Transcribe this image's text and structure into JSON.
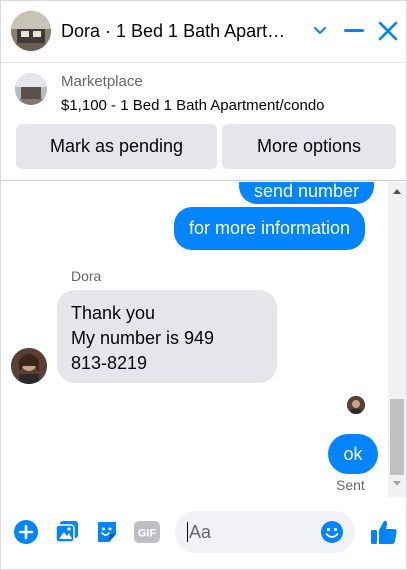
{
  "header": {
    "title": "Dora · 1 Bed 1 Bath Apart…",
    "icons": [
      "profile-photo",
      "chevron-down-icon",
      "minimize-icon",
      "close-icon"
    ]
  },
  "marketplace": {
    "label": "Marketplace",
    "listing": "$1,100 - 1 Bed 1 Bath Apartment/condo",
    "mark_pending_label": "Mark as pending",
    "more_options_label": "More options"
  },
  "thread": {
    "outgoing_partial": "send number",
    "outgoing_1": "for more information",
    "sender_name": "Dora",
    "incoming_lines": [
      "Thank you",
      "My number is 949",
      "813-8219"
    ],
    "outgoing_2": "ok",
    "status": "Sent"
  },
  "composer": {
    "placeholder": "Aa",
    "icons": [
      "plus-circle-icon",
      "photo-icon",
      "sticker-icon",
      "gif-icon",
      "emoji-icon",
      "thumbs-up-icon"
    ]
  },
  "colors": {
    "accent": "#0084ff",
    "bubble_in": "#e4e6eb",
    "secondary_text": "#65676b"
  }
}
